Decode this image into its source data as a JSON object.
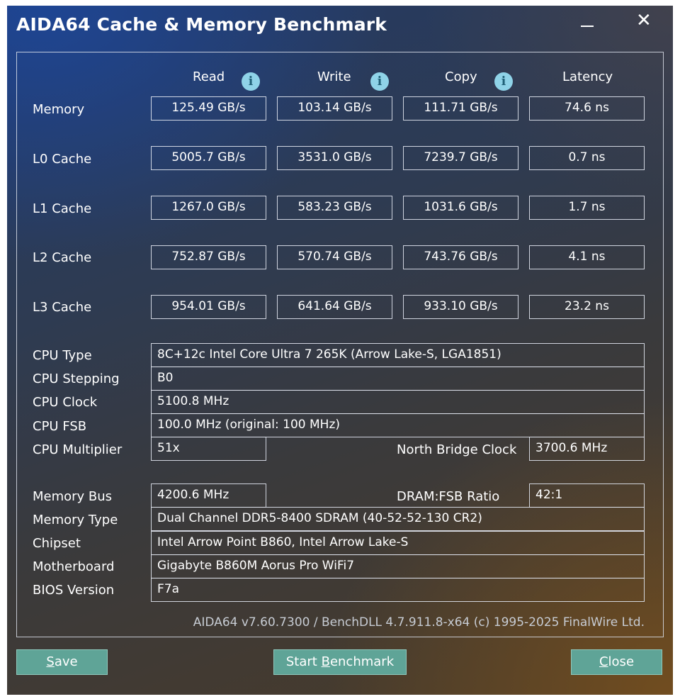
{
  "window": {
    "title": "AIDA64 Cache & Memory Benchmark"
  },
  "headers": {
    "read": "Read",
    "write": "Write",
    "copy": "Copy",
    "latency": "Latency"
  },
  "bench_rows": [
    {
      "label": "Memory",
      "read": "125.49 GB/s",
      "write": "103.14 GB/s",
      "copy": "111.71 GB/s",
      "latency": "74.6 ns"
    },
    {
      "label": "L0 Cache",
      "read": "5005.7 GB/s",
      "write": "3531.0 GB/s",
      "copy": "7239.7 GB/s",
      "latency": "0.7 ns"
    },
    {
      "label": "L1 Cache",
      "read": "1267.0 GB/s",
      "write": "583.23 GB/s",
      "copy": "1031.6 GB/s",
      "latency": "1.7 ns"
    },
    {
      "label": "L2 Cache",
      "read": "752.87 GB/s",
      "write": "570.74 GB/s",
      "copy": "743.76 GB/s",
      "latency": "4.1 ns"
    },
    {
      "label": "L3 Cache",
      "read": "954.01 GB/s",
      "write": "641.64 GB/s",
      "copy": "933.10 GB/s",
      "latency": "23.2 ns"
    }
  ],
  "cpu": {
    "type_label": "CPU Type",
    "type_value": "8C+12c Intel Core Ultra 7 265K  (Arrow Lake-S, LGA1851)",
    "stepping_label": "CPU Stepping",
    "stepping_value": "B0",
    "clock_label": "CPU Clock",
    "clock_value": "5100.8 MHz",
    "fsb_label": "CPU FSB",
    "fsb_value": "100.0 MHz  (original: 100 MHz)",
    "mult_label": "CPU Multiplier",
    "mult_value": "51x",
    "nb_label": "North Bridge Clock",
    "nb_value": "3700.6 MHz"
  },
  "mem": {
    "bus_label": "Memory Bus",
    "bus_value": "4200.6 MHz",
    "ratio_label": "DRAM:FSB Ratio",
    "ratio_value": "42:1",
    "type_label": "Memory Type",
    "type_value": "Dual Channel DDR5-8400 SDRAM  (40-52-52-130 CR2)",
    "chipset_label": "Chipset",
    "chipset_value": "Intel Arrow Point B860, Intel Arrow Lake-S",
    "mobo_label": "Motherboard",
    "mobo_value": "Gigabyte B860M Aorus Pro WiFi7",
    "bios_label": "BIOS Version",
    "bios_value": "F7a"
  },
  "footer": "AIDA64 v7.60.7300 / BenchDLL 4.7.911.8-x64  (c) 1995-2025 FinalWire Ltd.",
  "buttons": {
    "save_pre": "",
    "save_key": "S",
    "save_post": "ave",
    "start_pre": "Start ",
    "start_key": "B",
    "start_post": "enchmark",
    "close_pre": "",
    "close_key": "C",
    "close_post": "lose"
  },
  "icons": {
    "info": "info-icon",
    "close": "close-icon",
    "minimize": "minimize-icon"
  },
  "colors": {
    "button_bg": "#5fa497",
    "info_icon": "#8fd3e8"
  }
}
